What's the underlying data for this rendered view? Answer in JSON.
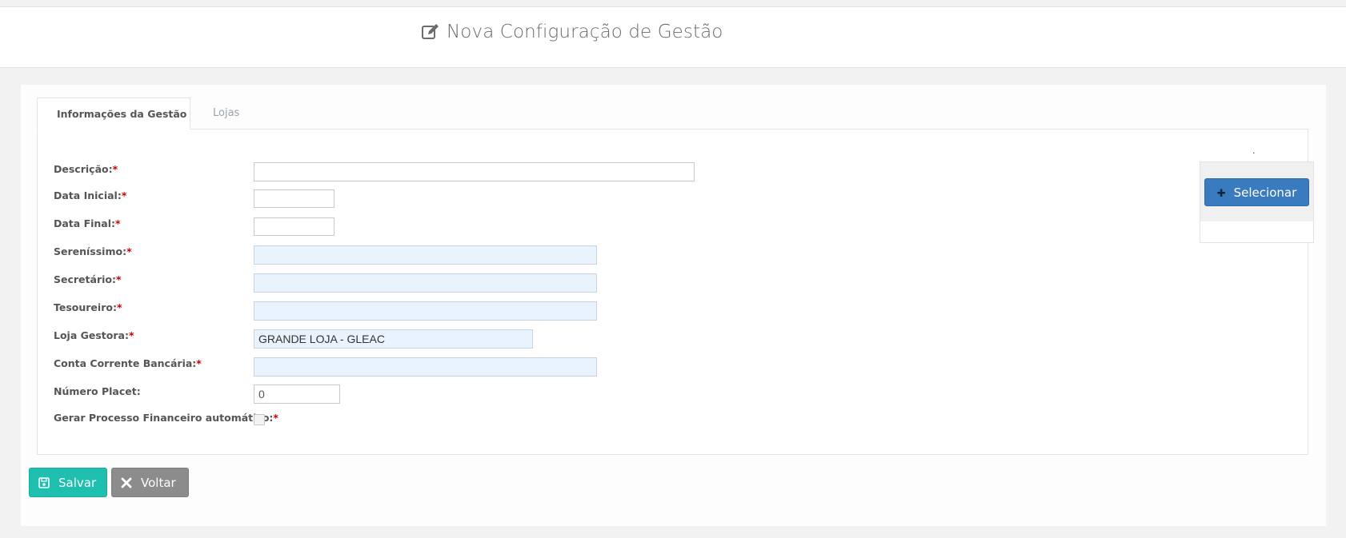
{
  "header": {
    "title": "Nova Configuração de Gestão",
    "icon": "edit-icon"
  },
  "tabs": [
    {
      "label": "Informações da Gestão",
      "active": true
    },
    {
      "label": "Lojas",
      "active": false
    }
  ],
  "form": {
    "required_marker": "*",
    "fields": {
      "descricao": {
        "label": "Descrição:",
        "value": ""
      },
      "data_inicial": {
        "label": "Data Inicial:",
        "value": ""
      },
      "data_final": {
        "label": "Data Final:",
        "value": ""
      },
      "serenissimo": {
        "label": "Sereníssimo:",
        "value": ""
      },
      "secretario": {
        "label": "Secretário:",
        "value": ""
      },
      "tesoureiro": {
        "label": "Tesoureiro:",
        "value": ""
      },
      "loja_gestora": {
        "label": "Loja Gestora:",
        "value": "GRANDE LOJA - GLEAC"
      },
      "conta_corrente": {
        "label": "Conta Corrente Bancária:",
        "value": ""
      },
      "numero_placet": {
        "label": "Número Placet:",
        "value": "0"
      },
      "gerar_processo": {
        "label": "Gerar Processo Financeiro automático:",
        "checked": false
      }
    }
  },
  "photo": {
    "dot": ".",
    "select_label": "Selecionar"
  },
  "actions": {
    "save_label": "Salvar",
    "back_label": "Voltar"
  },
  "colors": {
    "save": "#1ebfae",
    "back": "#8c8c8c",
    "select": "#3a7bbf",
    "required": "#cc0000"
  }
}
